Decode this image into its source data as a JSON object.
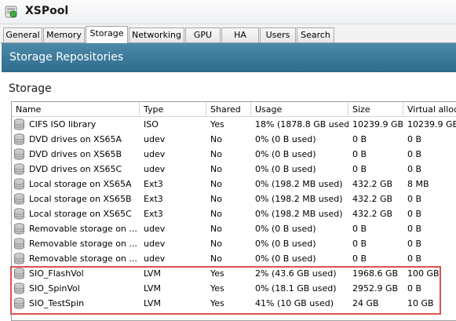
{
  "window": {
    "title": "XSPool",
    "icon": "pool-icon"
  },
  "tabs": [
    {
      "label": "General",
      "active": false
    },
    {
      "label": "Memory",
      "active": false
    },
    {
      "label": "Storage",
      "active": true
    },
    {
      "label": "Networking",
      "active": false
    },
    {
      "label": "GPU",
      "active": false
    },
    {
      "label": "HA",
      "active": false
    },
    {
      "label": "Users",
      "active": false
    },
    {
      "label": "Search",
      "active": false
    }
  ],
  "banner": {
    "title": "Storage Repositories"
  },
  "section": {
    "title": "Storage"
  },
  "table": {
    "columns": [
      "Name",
      "Type",
      "Shared",
      "Usage",
      "Size",
      "Virtual alloc"
    ],
    "rows": [
      {
        "name": "CIFS ISO library",
        "type": "ISO",
        "shared": "Yes",
        "usage": "18% (1878.8 GB used)",
        "size": "10239.9 GB",
        "virtual": "10239.9 GB"
      },
      {
        "name": "DVD drives on XS65A",
        "type": "udev",
        "shared": "No",
        "usage": "0% (0 B used)",
        "size": "0 B",
        "virtual": "0 B"
      },
      {
        "name": "DVD drives on XS65B",
        "type": "udev",
        "shared": "No",
        "usage": "0% (0 B used)",
        "size": "0 B",
        "virtual": "0 B"
      },
      {
        "name": "DVD drives on XS65C",
        "type": "udev",
        "shared": "No",
        "usage": "0% (0 B used)",
        "size": "0 B",
        "virtual": "0 B"
      },
      {
        "name": "Local storage on XS65A",
        "type": "Ext3",
        "shared": "No",
        "usage": "0% (198.2 MB used)",
        "size": "432.2 GB",
        "virtual": "8 MB"
      },
      {
        "name": "Local storage on XS65B",
        "type": "Ext3",
        "shared": "No",
        "usage": "0% (198.2 MB used)",
        "size": "432.2 GB",
        "virtual": "0 B"
      },
      {
        "name": "Local storage on XS65C",
        "type": "Ext3",
        "shared": "No",
        "usage": "0% (198.2 MB used)",
        "size": "432.2 GB",
        "virtual": "0 B"
      },
      {
        "name": "Removable storage on ...",
        "type": "udev",
        "shared": "No",
        "usage": "0% (0 B used)",
        "size": "0 B",
        "virtual": "0 B"
      },
      {
        "name": "Removable storage on ...",
        "type": "udev",
        "shared": "No",
        "usage": "0% (0 B used)",
        "size": "0 B",
        "virtual": "0 B"
      },
      {
        "name": "Removable storage on ...",
        "type": "udev",
        "shared": "No",
        "usage": "0% (0 B used)",
        "size": "0 B",
        "virtual": "0 B"
      },
      {
        "name": "SIO_FlashVol",
        "type": "LVM",
        "shared": "Yes",
        "usage": "2% (43.6 GB used)",
        "size": "1968.6 GB",
        "virtual": "100 GB"
      },
      {
        "name": "SIO_SpinVol",
        "type": "LVM",
        "shared": "Yes",
        "usage": "0% (18.1 GB used)",
        "size": "2952.9 GB",
        "virtual": "0 B"
      },
      {
        "name": "SIO_TestSpin",
        "type": "LVM",
        "shared": "Yes",
        "usage": "41% (10 GB used)",
        "size": "24 GB",
        "virtual": "10 GB"
      }
    ]
  },
  "colors": {
    "banner": "#3a7a9c",
    "highlight": "#d9534f",
    "tab_border": "#a9a9a9"
  }
}
